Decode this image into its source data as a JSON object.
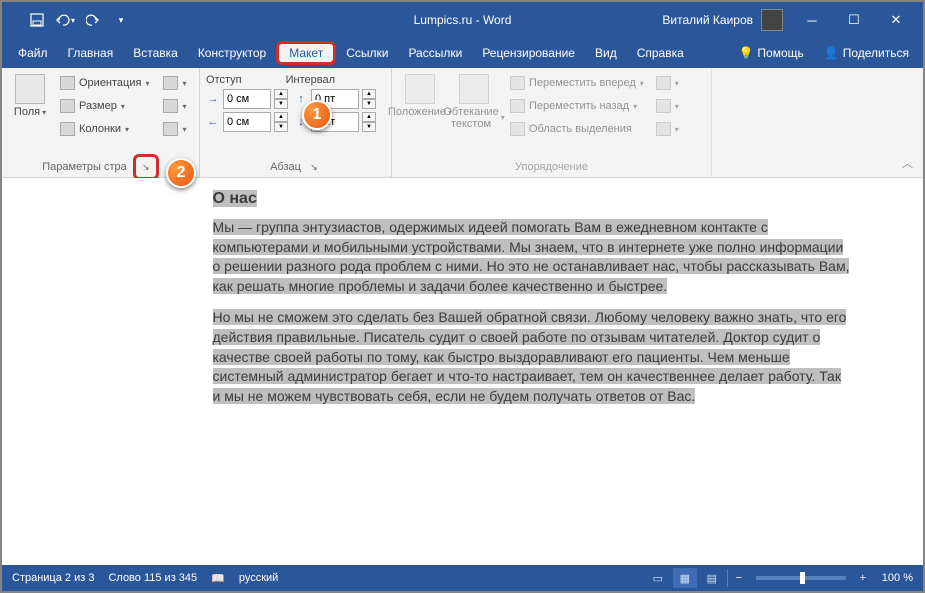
{
  "titlebar": {
    "title": "Lumpics.ru - Word",
    "user": "Виталий Каиров"
  },
  "tabs": {
    "file": "Файл",
    "home": "Главная",
    "insert": "Вставка",
    "design": "Конструктор",
    "layout": "Макет",
    "references": "Ссылки",
    "mailings": "Рассылки",
    "review": "Рецензирование",
    "view": "Вид",
    "help": "Справка",
    "tell": "Помощь",
    "share": "Поделиться"
  },
  "ribbon": {
    "page_setup": {
      "margins": "Поля",
      "orientation": "Ориентация",
      "size": "Размер",
      "columns": "Колонки",
      "group": "Параметры стра"
    },
    "paragraph": {
      "indent": "Отступ",
      "left": "0 см",
      "right": "0 см",
      "spacing": "Интервал",
      "before": "0 пт",
      "after": "8 пт",
      "group": "Абзац"
    },
    "arrange": {
      "position": "Положение",
      "wrap": "Обтекание текстом",
      "forward": "Переместить вперед",
      "backward": "Переместить назад",
      "selection": "Область выделения",
      "group": "Упорядочение"
    }
  },
  "document": {
    "heading": "О нас",
    "p1": "Мы — группа энтузиастов, одержимых идеей помогать Вам в ежедневном контакте с компьютерами и мобильными устройствами. Мы знаем, что в интернете уже полно информации о решении разного рода проблем с ними. Но это не останавливает нас, чтобы рассказывать Вам, как решать многие проблемы и задачи более качественно и быстрее.",
    "p2": "Но мы не сможем это сделать без Вашей обратной связи. Любому человеку важно знать, что его действия правильные. Писатель судит о своей работе по отзывам читателей. Доктор судит о качестве своей работы по тому, как быстро выздоравливают его пациенты. Чем меньше системный администратор бегает и что-то настраивает, тем он качественнее делает работу. Так и мы не можем чувствовать себя, если не будем получать ответов от Вас."
  },
  "status": {
    "page": "Страница 2 из 3",
    "words": "Слово 115 из 345",
    "lang": "русский",
    "zoom": "100 %"
  },
  "callouts": {
    "one": "1",
    "two": "2"
  }
}
